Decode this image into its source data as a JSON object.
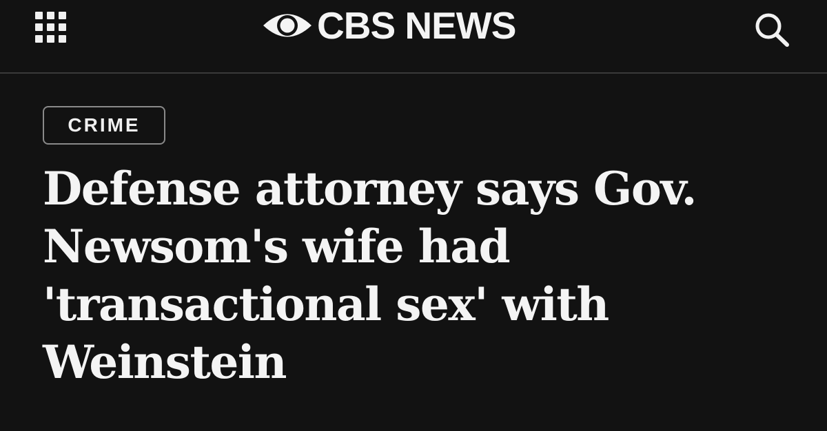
{
  "header": {
    "logo_text": "CBS NEWS",
    "menu_icon": "grid-menu-icon",
    "logo_icon": "cbs-eye-icon",
    "search_icon": "search-icon"
  },
  "article": {
    "category": "CRIME",
    "headline": "Defense attorney says Gov. Newsom's wife had 'transactional sex' with Weinstein"
  },
  "colors": {
    "background": "#121212",
    "text": "#f4f4f4",
    "divider": "#3a3a3a",
    "badge_border": "#8a8a8a"
  }
}
